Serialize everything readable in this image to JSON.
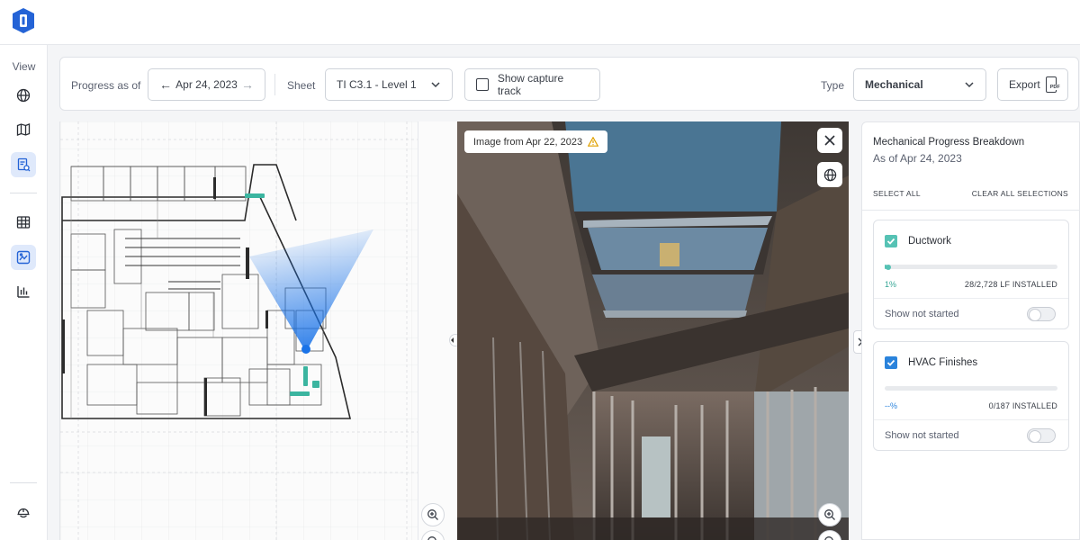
{
  "brand": {
    "logo_icon": "logo-icon",
    "accent": "#2463d6"
  },
  "rail": {
    "view_label": "View",
    "items": [
      {
        "icon": "globe-icon",
        "active": false
      },
      {
        "icon": "map-icon",
        "active": false
      },
      {
        "icon": "progress-report-icon",
        "active": true
      },
      {
        "icon": "table-icon",
        "active": false
      },
      {
        "icon": "image-map-icon",
        "active": true
      },
      {
        "icon": "bar-chart-icon",
        "active": false
      },
      {
        "icon": "hard-hat-icon",
        "active": false
      }
    ]
  },
  "toolbar": {
    "progress_label": "Progress as of",
    "date_value": "Apr 24, 2023",
    "sheet_label": "Sheet",
    "sheet_value": "TI C3.1 - Level 1",
    "capture_track_label": "Show capture track",
    "capture_track_checked": false,
    "type_label": "Type",
    "type_value": "Mechanical",
    "export_label": "Export",
    "export_badge": "PDF"
  },
  "photo": {
    "image_date_label": "Image from Apr 22, 2023",
    "warning_icon": "warning-icon",
    "warning_color": "#e0a100"
  },
  "breakdown": {
    "title": "Mechanical Progress Breakdown",
    "subtitle": "As of Apr 24, 2023",
    "select_all": "SELECT ALL",
    "clear_all": "CLEAR ALL SELECTIONS",
    "items": [
      {
        "name": "Ductwork",
        "checked": true,
        "progress_fraction": 0.01,
        "percent": "1%",
        "installed": "28/2,728 LF INSTALLED",
        "show_not_started": "Show not started",
        "check_color": "#56c2b4",
        "pct_color": "#35a695"
      },
      {
        "name": "HVAC Finishes",
        "checked": true,
        "progress_fraction": 0,
        "percent": "--%",
        "installed": "0/187 INSTALLED",
        "show_not_started": "Show not started",
        "check_color": "#2a83dc",
        "pct_color": "#2a83dc"
      }
    ]
  }
}
